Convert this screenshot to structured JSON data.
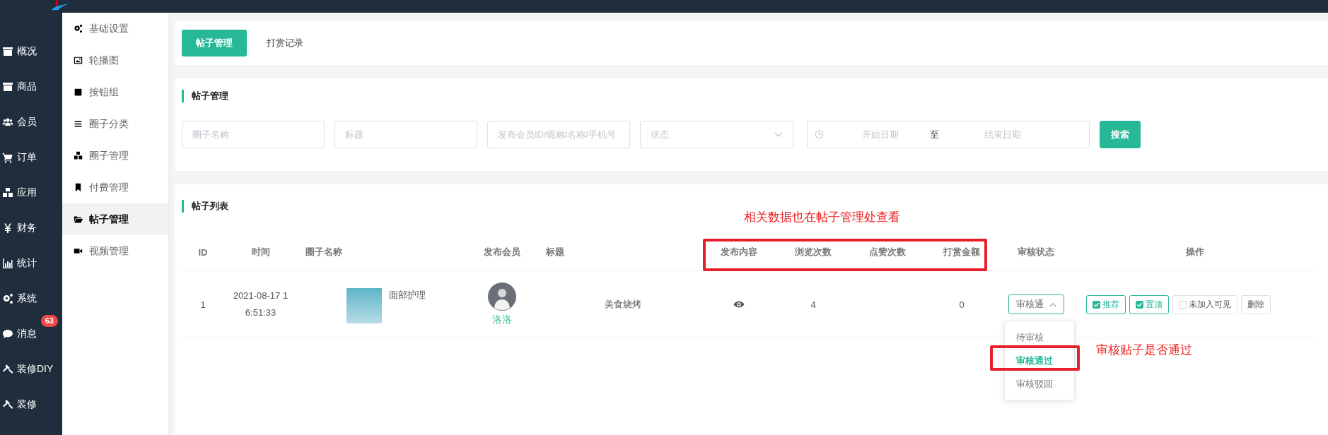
{
  "sidebar": {
    "items": [
      {
        "label": "概况"
      },
      {
        "label": "商品"
      },
      {
        "label": "会员"
      },
      {
        "label": "订单"
      },
      {
        "label": "应用"
      },
      {
        "label": "财务"
      },
      {
        "label": "统计"
      },
      {
        "label": "系统"
      },
      {
        "label": "消息",
        "badge": "63"
      },
      {
        "label": "装修DIY"
      },
      {
        "label": "装修"
      }
    ]
  },
  "submenu": {
    "items": [
      {
        "label": "基础设置",
        "selected": false
      },
      {
        "label": "轮播图",
        "selected": false
      },
      {
        "label": "按钮组",
        "selected": false
      },
      {
        "label": "圈子分类",
        "selected": false
      },
      {
        "label": "圈子管理",
        "selected": false
      },
      {
        "label": "付费管理",
        "selected": false
      },
      {
        "label": "帖子管理",
        "selected": true
      },
      {
        "label": "视频管理",
        "selected": false
      }
    ]
  },
  "tabs": [
    {
      "label": "帖子管理",
      "selected": true
    },
    {
      "label": "打赏记录",
      "selected": false
    }
  ],
  "filter": {
    "title": "帖子管理",
    "fields": [
      {
        "placeholder": "圈子名称"
      },
      {
        "placeholder": "标题"
      },
      {
        "placeholder": "发布会员ID/昵称/名称/手机号"
      }
    ],
    "status_select": {
      "placeholder": "状态"
    },
    "date_range": {
      "start_placeholder": "开始日期",
      "separator": "至",
      "end_placeholder": "结束日期"
    },
    "search_button": "搜索"
  },
  "table": {
    "title": "帖子列表",
    "columns": [
      "ID",
      "时间",
      "圈子名称",
      "发布会员",
      "标题",
      "发布内容",
      "浏览次数",
      "点赞次数",
      "打赏金额",
      "审核状态",
      "操作"
    ],
    "rows": [
      {
        "id": "1",
        "time": "2021-08-17 16:51:33",
        "circle": "面部护理",
        "member": "洛洛",
        "title": "美食烧烤",
        "views": "4",
        "reward": "0",
        "status": {
          "value": "审核通",
          "expanded": true,
          "options": [
            {
              "label": "待审核",
              "selected": false
            },
            {
              "label": "审核通过",
              "selected": true
            },
            {
              "label": "审核驳回",
              "selected": false
            }
          ]
        },
        "actions": [
          {
            "kind": "checkbox",
            "label": "推荐",
            "checked": true
          },
          {
            "kind": "checkbox",
            "label": "置顶",
            "checked": true
          },
          {
            "kind": "checkbox",
            "label": "未加入可见",
            "checked": false
          },
          {
            "kind": "button",
            "label": "删除"
          }
        ]
      }
    ]
  },
  "annotations": [
    {
      "text": "相关数据也在帖子管理处查看"
    },
    {
      "text": "审核贴子是否通过"
    }
  ]
}
